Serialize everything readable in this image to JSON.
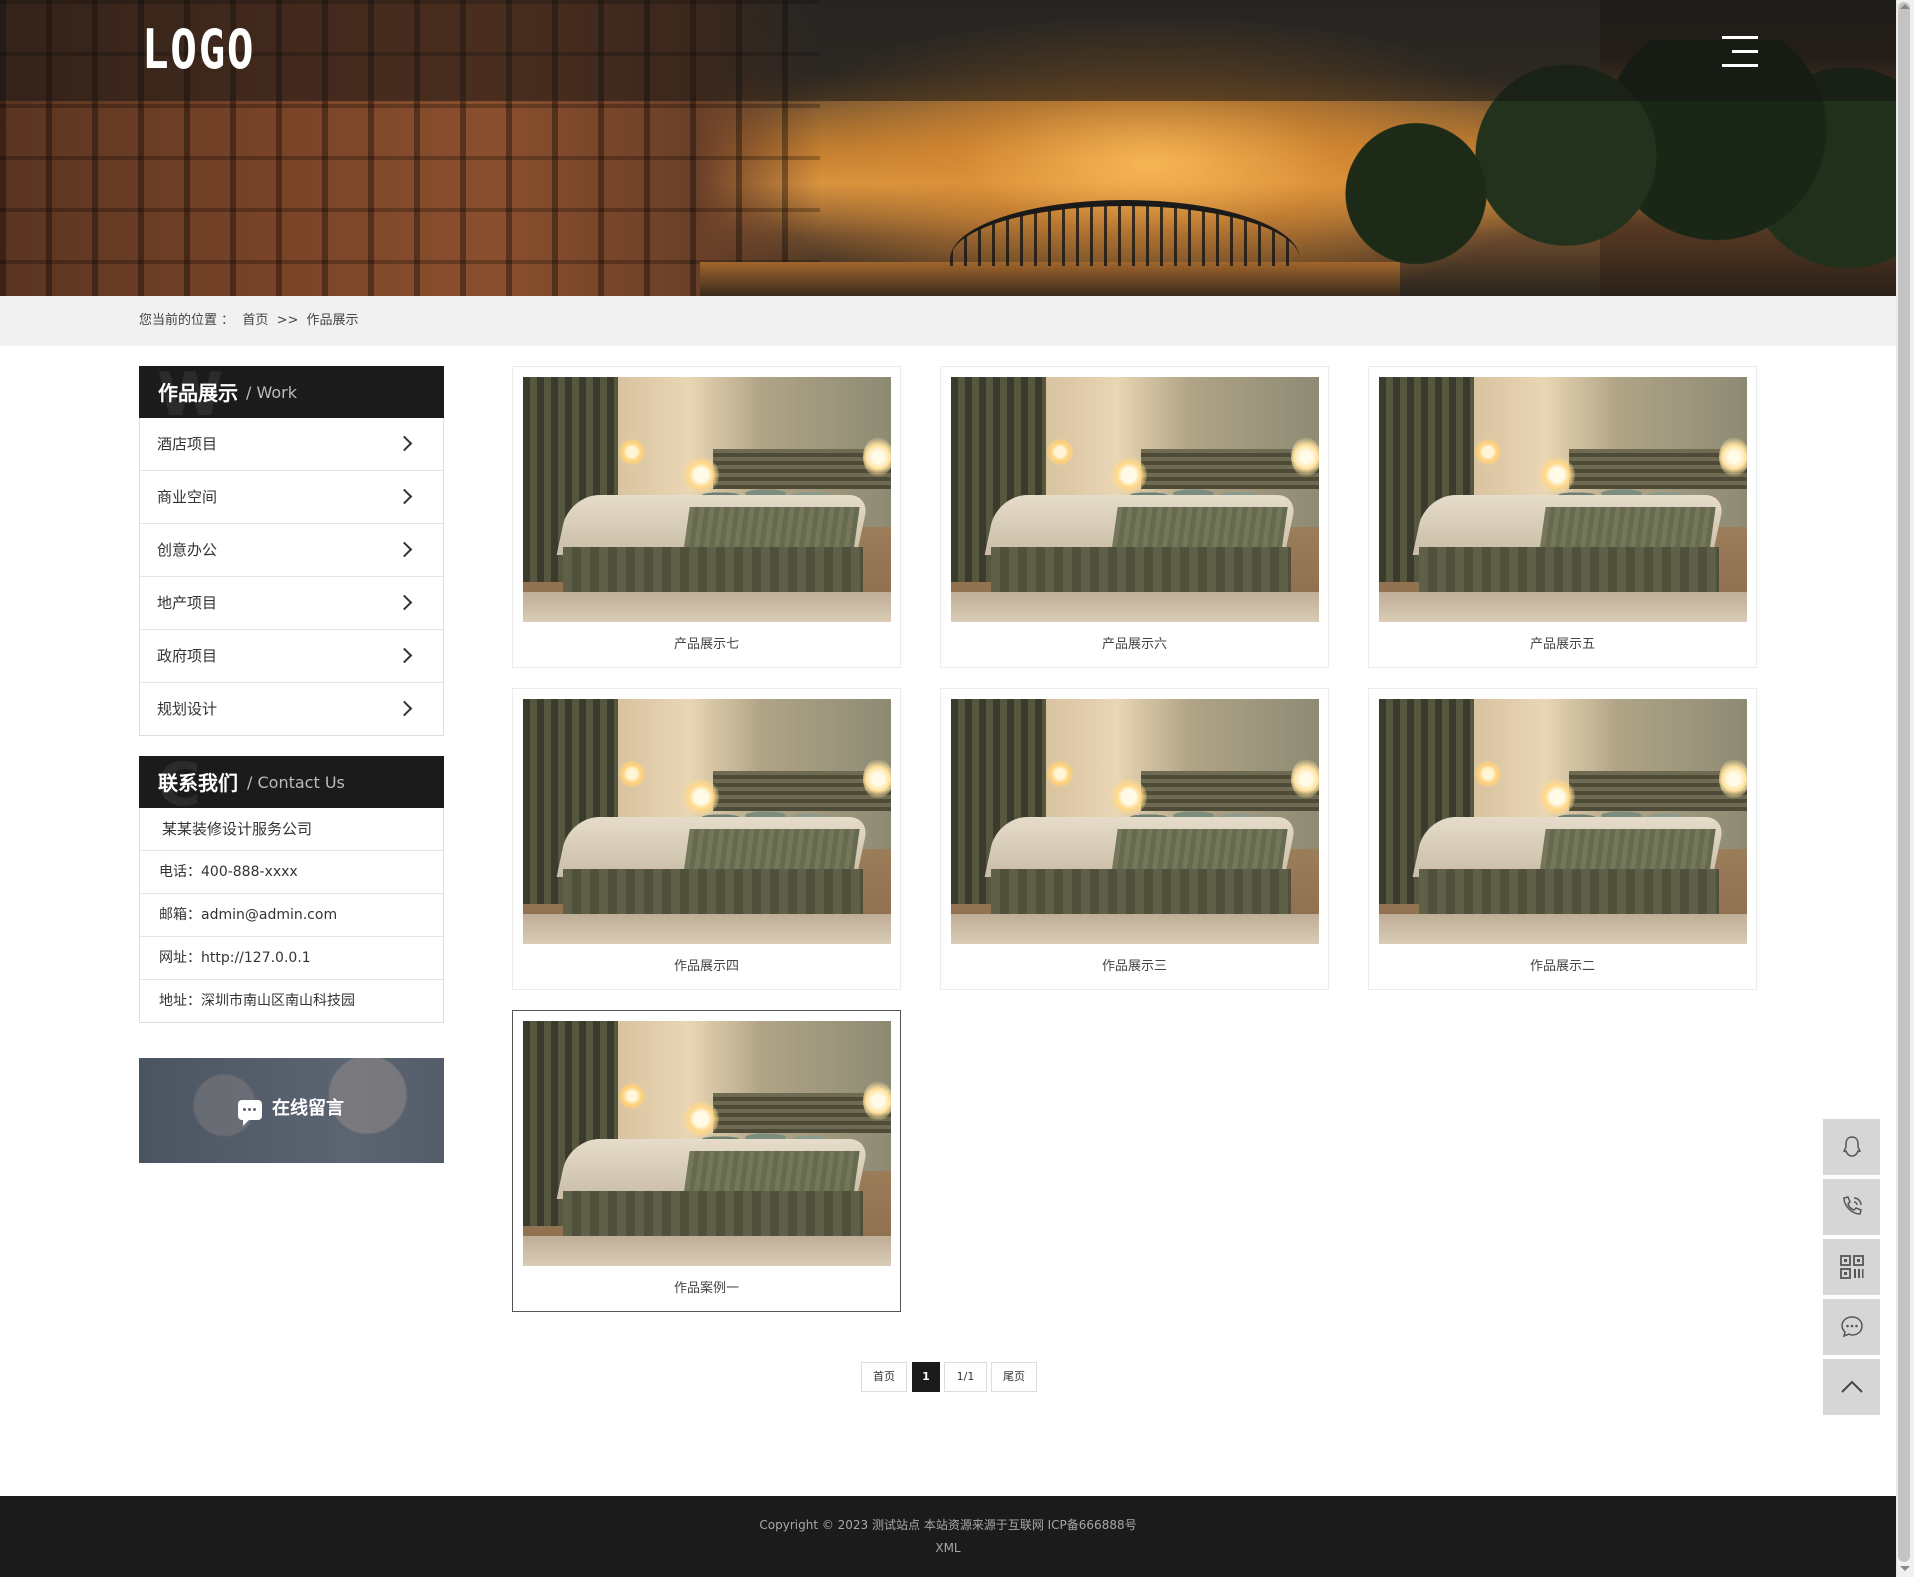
{
  "header": {
    "logo_text": "LOGO",
    "menu_icon": "hamburger-menu-icon"
  },
  "breadcrumb": {
    "prefix": "您当前的位置 ：",
    "home": "首页",
    "separator": ">>",
    "current": "作品展示"
  },
  "sidebar": {
    "work_title": "作品展示",
    "work_subtitle": "/ Work",
    "categories": [
      {
        "label": "酒店项目"
      },
      {
        "label": "商业空间"
      },
      {
        "label": "创意办公"
      },
      {
        "label": "地产项目"
      },
      {
        "label": "政府项目"
      },
      {
        "label": "规划设计"
      }
    ],
    "contact_title": "联系我们",
    "contact_subtitle": "/ Contact Us",
    "contact": {
      "company": "某某装修设计服务公司",
      "phone": "电话：400-888-xxxx",
      "email": "邮箱：admin@admin.com",
      "website": "网址：http://127.0.0.1",
      "address": "地址：深圳市南山区南山科技园"
    },
    "message_button": "在线留言"
  },
  "products": [
    {
      "caption": "产品展示七"
    },
    {
      "caption": "产品展示六"
    },
    {
      "caption": "产品展示五"
    },
    {
      "caption": "作品展示四"
    },
    {
      "caption": "作品展示三"
    },
    {
      "caption": "作品展示二"
    },
    {
      "caption": "作品案例一"
    }
  ],
  "pagination": {
    "first": "首页",
    "current": "1",
    "total": "1/1",
    "last": "尾页"
  },
  "float_toolbar": {
    "items": [
      "qq-icon",
      "phone-icon",
      "qrcode-icon",
      "chat-icon",
      "back-to-top-icon"
    ]
  },
  "footer": {
    "copyright": "Copyright © 2023 测试站点 本站资源来源于互联网 ICP备666888号",
    "xml": "XML"
  },
  "colors": {
    "dark": "#1b1b1b",
    "breadcrumb_bg": "#f1f1f1",
    "float_button_bg": "#d6d6d6"
  }
}
